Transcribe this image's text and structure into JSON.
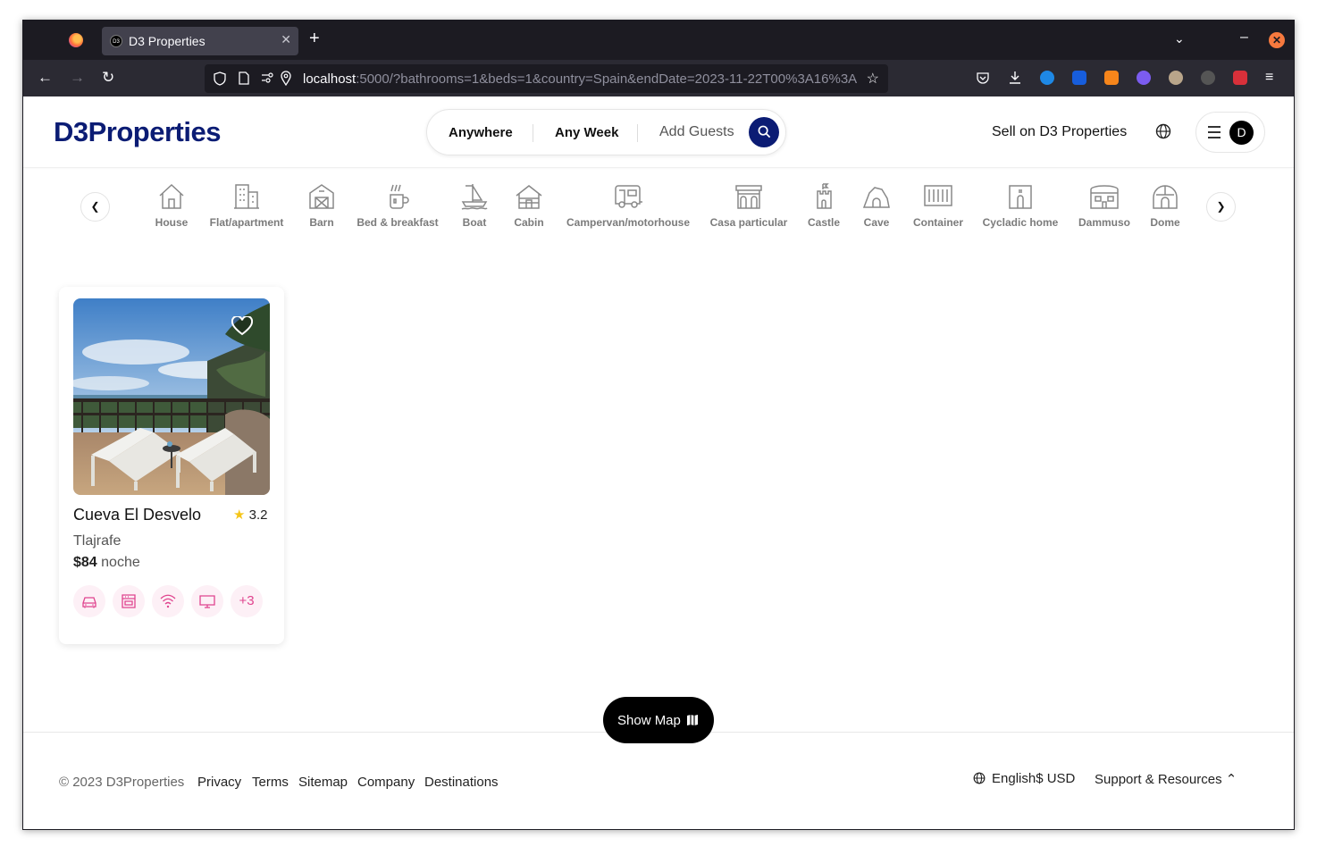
{
  "browser": {
    "tab_title": "D3 Properties",
    "tab_favicon": "D3",
    "url_host": "localhost",
    "url_rest": ":5000/?bathrooms=1&beds=1&country=Spain&endDate=2023-11-22T00%3A16%3A"
  },
  "header": {
    "logo": "D3Properties",
    "search": {
      "anywhere": "Anywhere",
      "any_week": "Any Week",
      "add_guests": "Add Guests"
    },
    "sell_link": "Sell on D3 Properties",
    "avatar_initial": "D"
  },
  "categories": [
    {
      "label": "House",
      "icon": "house-icon"
    },
    {
      "label": "Flat/apartment",
      "icon": "building-icon"
    },
    {
      "label": "Barn",
      "icon": "barn-icon"
    },
    {
      "label": "Bed & breakfast",
      "icon": "coffee-icon"
    },
    {
      "label": "Boat",
      "icon": "sailboat-icon"
    },
    {
      "label": "Cabin",
      "icon": "cabin-icon"
    },
    {
      "label": "Campervan/motorhouse",
      "icon": "campervan-icon"
    },
    {
      "label": "Casa particular",
      "icon": "casa-icon"
    },
    {
      "label": "Castle",
      "icon": "castle-icon"
    },
    {
      "label": "Cave",
      "icon": "cave-icon"
    },
    {
      "label": "Container",
      "icon": "container-icon"
    },
    {
      "label": "Cycladic home",
      "icon": "cycladic-icon"
    },
    {
      "label": "Dammuso",
      "icon": "dammuso-icon"
    },
    {
      "label": "Dome",
      "icon": "dome-icon"
    }
  ],
  "listing": {
    "title": "Cueva El Desvelo",
    "rating": "3.2",
    "location": "Tlajrafe",
    "price": "$84",
    "price_unit": "noche",
    "amenities": [
      "car-icon",
      "oven-icon",
      "wifi-icon",
      "tv-icon"
    ],
    "more_amenities": "+3"
  },
  "show_map": "Show Map",
  "footer": {
    "copyright": "© 2023 D3Properties",
    "links": [
      "Privacy",
      "Terms",
      "Sitemap",
      "Company",
      "Destinations"
    ],
    "language": "English",
    "currency": "$ USD",
    "support": "Support & Resources"
  },
  "colors": {
    "brand": "#0b1c74",
    "amenity": "#e0458f",
    "chrome": "#1c1b22"
  }
}
